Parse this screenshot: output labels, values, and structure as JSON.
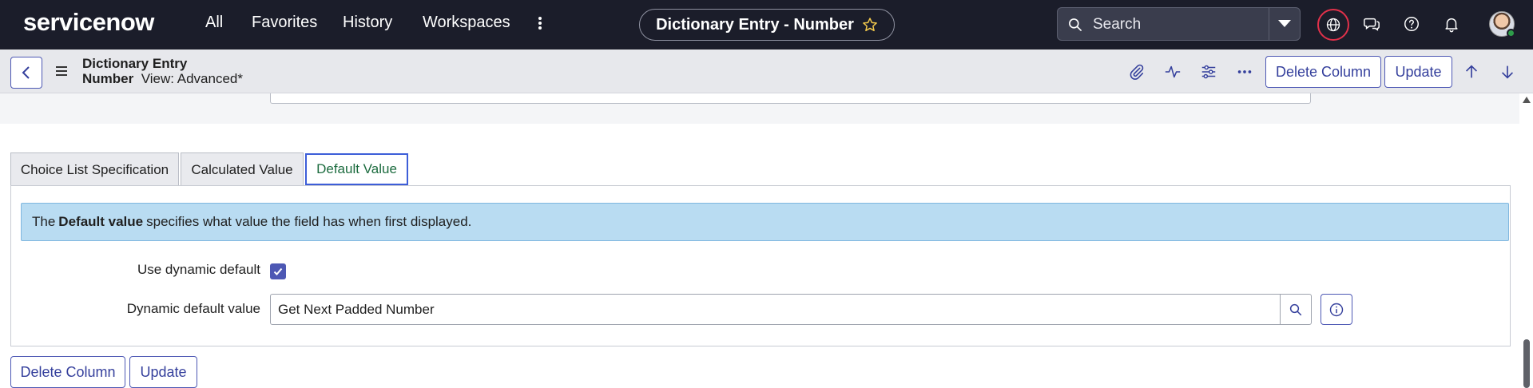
{
  "topnav": {
    "logo": "servicenow",
    "links": [
      "All",
      "Favorites",
      "History",
      "Workspaces"
    ],
    "record_title": "Dictionary Entry - Number",
    "search_placeholder": "Search",
    "icons": [
      "more-vertical-icon",
      "star-icon",
      "search-icon",
      "chevron-down-icon",
      "globe-icon",
      "chat-icon",
      "help-icon",
      "bell-icon"
    ]
  },
  "subheader": {
    "title_line1": "Dictionary Entry",
    "title_line2_bold": "Number",
    "view_label": "View: Advanced*",
    "delete_label": "Delete Column",
    "update_label": "Update",
    "icons": [
      "back-icon",
      "menu-icon",
      "attachment-icon",
      "activity-icon",
      "settings-icon",
      "more-horizontal-icon",
      "arrow-up-icon",
      "arrow-down-icon"
    ]
  },
  "tabs": [
    {
      "label": "Choice List Specification",
      "active": false
    },
    {
      "label": "Calculated Value",
      "active": false
    },
    {
      "label": "Default Value",
      "active": true
    }
  ],
  "info": {
    "prefix": "The",
    "bold": "Default value",
    "suffix": "specifies what value the field has when first displayed."
  },
  "fields": {
    "use_dynamic_label": "Use dynamic default",
    "use_dynamic_checked": true,
    "dynamic_value_label": "Dynamic default value",
    "dynamic_value": "Get Next Padded Number"
  },
  "footer": {
    "delete_label": "Delete Column",
    "update_label": "Update"
  },
  "colors": {
    "nav_bg": "#1b1d2a",
    "accent": "#4d58b4",
    "info_bg": "#b9dcf2",
    "active_tab_border": "#3d5ed8"
  }
}
